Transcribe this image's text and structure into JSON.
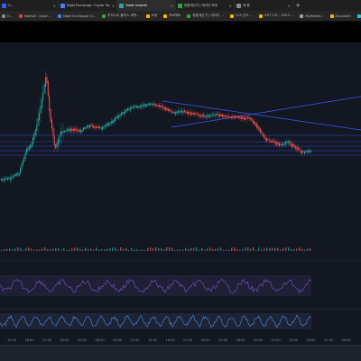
{
  "browser": {
    "tabs": [
      {
        "label": "O...",
        "color": "#2962ff",
        "active": false
      },
      {
        "label": "Nigel Exchange: Crypto Trad",
        "color": "#4a7cff",
        "active": false
      },
      {
        "label": "Trade smarter",
        "color": "#2aa3a3",
        "active": true
      },
      {
        "label": "한통계산기 | 데이터 모바",
        "color": "#27a844",
        "active": false
      },
      {
        "label": "새 탭",
        "color": "#8a8a8a",
        "active": false
      }
    ],
    "new_tab_label": "+",
    "bookmarks": [
      {
        "label": "O...",
        "color": "#8a8a8a"
      },
      {
        "label": "Nemoll - Send ...",
        "color": "#e53935"
      },
      {
        "label": "Nigel Exchange Cr...",
        "color": "#4a7cff"
      },
      {
        "label": "투자노트 플러스 과학...",
        "color": "#27a844"
      },
      {
        "label": "쇼핑",
        "color": "#ffb300"
      },
      {
        "label": "프로젝트",
        "color": "#ffb300"
      },
      {
        "label": "한통계산기 | 데이터 ...",
        "color": "#27a844"
      },
      {
        "label": "CLS 잔고 ...",
        "color": "#ffb300"
      },
      {
        "label": "GST 시드 - 2023 ...",
        "color": "#ffb300"
      },
      {
        "label": "MyHolder...",
        "color": "#9e9e9e"
      },
      {
        "label": "Anyalarm",
        "color": "#ffb300"
      },
      {
        "label": "큐레이터 | Pro...",
        "color": "#26c6da"
      }
    ]
  },
  "chart": {
    "colors": {
      "background": "#131722",
      "up": "#26a69a",
      "down": "#ef5350",
      "trendline": "#3d5afe",
      "level": "#3d5afe",
      "oscillator1": "#7e57c2",
      "oscillator2": "#5c8bd6"
    },
    "time_labels": [
      "15:00",
      "18:00",
      "21:00",
      "00:00",
      "03:00",
      "06:00",
      "09:00",
      "12:00",
      "15:00",
      "18:00",
      "21:00",
      "00:00",
      "03:00",
      "06:00",
      "09:00",
      "12:00",
      "15:00",
      "18:00",
      "21:00",
      "00:00"
    ]
  }
}
